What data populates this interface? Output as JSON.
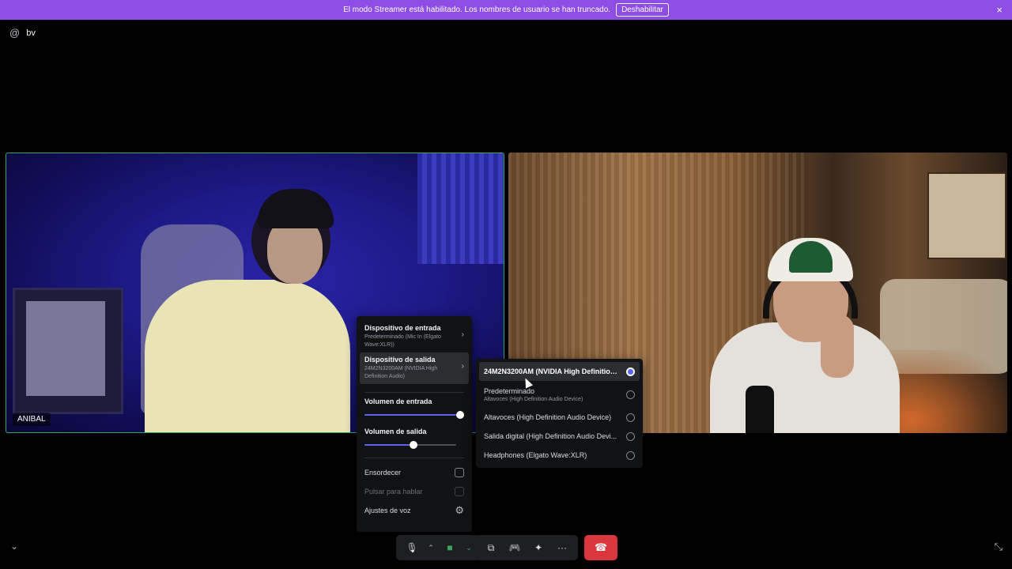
{
  "banner": {
    "message": "El modo Streamer está habilitado. Los nombres de usuario se han truncado.",
    "button_label": "Deshabilitar",
    "close_icon": "×"
  },
  "channel": {
    "icon": "@",
    "name": "bv"
  },
  "participants": [
    {
      "name": "ANIBAL",
      "speaking": true
    },
    {
      "name": ""
    }
  ],
  "menu": {
    "input_device_title": "Dispositivo de entrada",
    "input_device_value": "Predeterminado (Mic In (Elgato Wave:XLR))",
    "output_device_title": "Dispositivo de salida",
    "output_device_value": "24M2N3200AM (NVIDIA High Definition Audio)",
    "input_volume_label": "Volumen de entrada",
    "input_volume": 1.0,
    "output_volume_label": "Volumen de salida",
    "output_volume": 0.5,
    "deafen_label": "Ensordecer",
    "ptt_label": "Pulsar para hablar",
    "voice_settings_label": "Ajustes de voz"
  },
  "output_devices": [
    {
      "label": "24M2N3200AM (NVIDIA High Definition ...",
      "sublabel": "",
      "selected": true
    },
    {
      "label": "Predeterminado",
      "sublabel": "Altavoces (High Definition Audio Device)",
      "selected": false
    },
    {
      "label": "Altavoces (High Definition Audio Device)",
      "sublabel": "",
      "selected": false
    },
    {
      "label": "Salida digital (High Definition Audio Devi...",
      "sublabel": "",
      "selected": false
    },
    {
      "label": "Headphones (Elgato Wave:XLR)",
      "sublabel": "",
      "selected": false
    }
  ],
  "colors": {
    "banner": "#8e4ee6",
    "speaking_border": "#3ba55d",
    "accent": "#5865f2",
    "hangup": "#da373c"
  }
}
